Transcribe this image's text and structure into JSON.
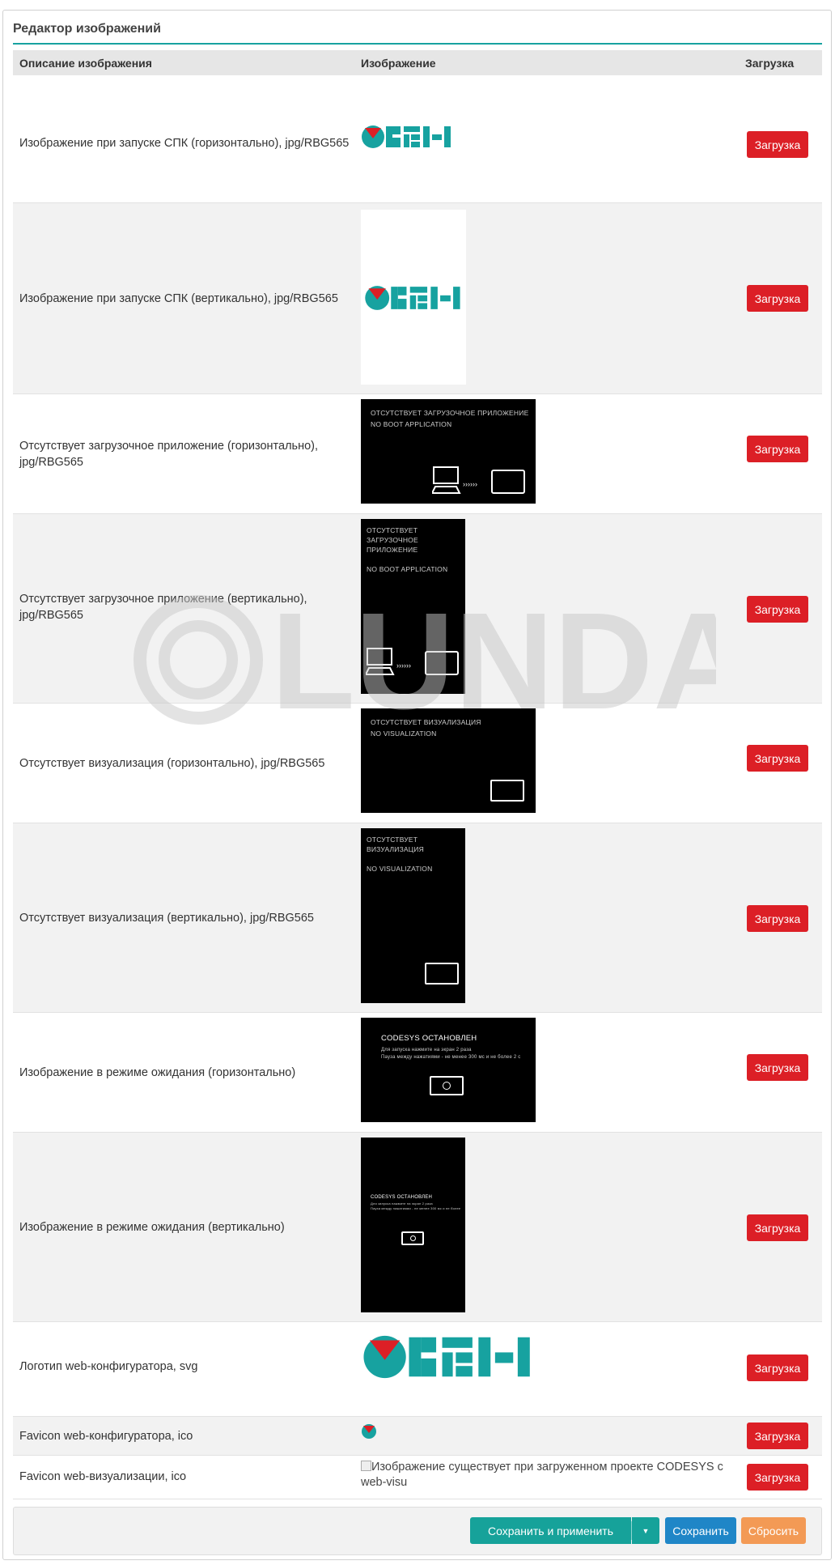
{
  "panel": {
    "title": "Редактор изображений"
  },
  "columns": {
    "description": "Описание изображения",
    "image": "Изображение",
    "upload": "Загрузка"
  },
  "brand": {
    "logo_text": "ОВЕН",
    "teal": "#17a2a0",
    "red": "#dc1f26"
  },
  "rows": [
    {
      "label": "Изображение при запуске СПК (горизонтально), jpg/RBG565",
      "button": "Загрузка"
    },
    {
      "label": "Изображение при запуске СПК (вертикально), jpg/RBG565",
      "button": "Загрузка"
    },
    {
      "label": "Отсутствует загрузочное приложение (горизонтально), jpg/RBG565",
      "button": "Загрузка"
    },
    {
      "label": "Отсутствует загрузочное приложение (вертикально), jpg/RBG565",
      "button": "Загрузка"
    },
    {
      "label": "Отсутствует визуализация (горизонтально), jpg/RBG565",
      "button": "Загрузка"
    },
    {
      "label": "Отсутствует визуализация (вертикально), jpg/RBG565",
      "button": "Загрузка"
    },
    {
      "label": "Изображение в режиме ожидания (горизонтально)",
      "button": "Загрузка"
    },
    {
      "label": "Изображение в режиме ожидания (вертикально)",
      "button": "Загрузка"
    },
    {
      "label": "Логотип web-конфигуратора, svg",
      "button": "Загрузка"
    },
    {
      "label": "Favicon web-конфигуратора, ico",
      "button": "Загрузка"
    },
    {
      "label": "Favicon web-визуализации, ico",
      "button": "Загрузка"
    }
  ],
  "screens": {
    "no_boot_h": {
      "line1": "ОТСУТСТВУЕТ ЗАГРУЗОЧНОЕ ПРИЛОЖЕНИЕ",
      "line2": "NO BOOT APPLICATION"
    },
    "no_boot_v": {
      "line1": "ОТСУТСТВУЕТ",
      "line2": "ЗАГРУЗОЧНОЕ",
      "line3": "ПРИЛОЖЕНИЕ",
      "line4": "NO BOOT APPLICATION"
    },
    "no_visu_h": {
      "line1": "ОТСУТСТВУЕТ ВИЗУАЛИЗАЦИЯ",
      "line2": "NO VISUALIZATION"
    },
    "no_visu_v": {
      "line1": "ОТСУТСТВУЕТ",
      "line2": "ВИЗУАЛИЗАЦИЯ",
      "line3": "NO VISUALIZATION"
    },
    "standby_h": {
      "title": "CODESYS ОСТАНОВЛЕН",
      "line1": "Для запуска нажмите на экран 2 раза",
      "line2": "Пауза между нажатиями - не менее 300 мс и не более 2 с"
    },
    "standby_v": {
      "title": "CODESYS ОСТАНОВЛЕН",
      "line1": "Для запуска нажмите на экран 2 раза",
      "line2": "Пауза между нажатиями - не менее 300 мс и не более 2 с"
    }
  },
  "missing_image_alt": "Изображение существует при загруженном проекте CODESYS с web-visu",
  "watermark": "LUNDA",
  "footer": {
    "save_apply": "Сохранить и применить",
    "save": "Сохранить",
    "reset": "Сбросить"
  }
}
